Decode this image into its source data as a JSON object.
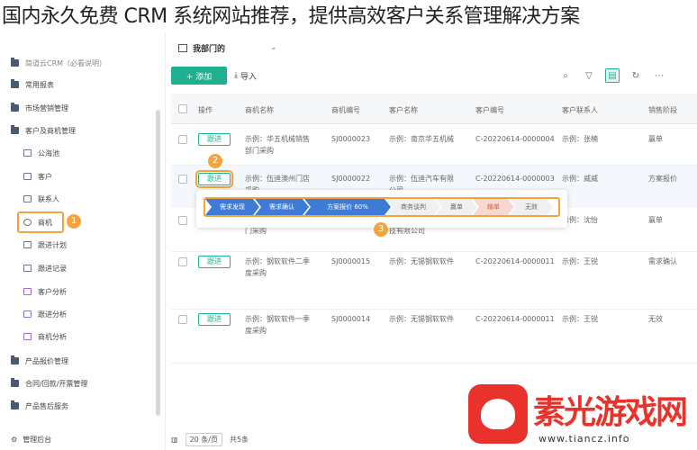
{
  "overlay_title": "国内永久免费 CRM 系统网站推荐，提供高效客户关系管理解决方案",
  "sidebar": {
    "items": [
      {
        "label": "简道云CRM（必看说明）",
        "type": "folder"
      },
      {
        "label": "常用报表",
        "type": "folder"
      },
      {
        "label": "市场营销管理",
        "type": "folder"
      },
      {
        "label": "客户及商机管理",
        "type": "folder"
      },
      {
        "label": "公海池",
        "type": "sub"
      },
      {
        "label": "客户",
        "type": "sub"
      },
      {
        "label": "联系人",
        "type": "sub"
      },
      {
        "label": "商机",
        "type": "sub"
      },
      {
        "label": "跟进计划",
        "type": "sub"
      },
      {
        "label": "跟进记录",
        "type": "sub"
      },
      {
        "label": "客户分析",
        "type": "sub"
      },
      {
        "label": "跟进分析",
        "type": "sub"
      },
      {
        "label": "商机分析",
        "type": "sub"
      },
      {
        "label": "产品报价管理",
        "type": "folder"
      },
      {
        "label": "合同/回款/开票管理",
        "type": "folder"
      },
      {
        "label": "产品售后服务",
        "type": "folder"
      }
    ],
    "admin_label": "管理后台"
  },
  "badges": {
    "one": "1",
    "two": "2",
    "three": "3"
  },
  "topbar": {
    "view_name": "我部门的",
    "chevron": "⌄"
  },
  "toolbar": {
    "add_label": "+ 添加",
    "import_label": "导入",
    "icons": [
      "search-icon",
      "filter-icon",
      "card-view-icon",
      "refresh-icon",
      "more-icon"
    ]
  },
  "table": {
    "headers": [
      "操作",
      "商机名称",
      "商机编号",
      "客户名称",
      "客户编号",
      "客户联系人",
      "销售阶段"
    ],
    "follow_label": "跟进",
    "rows": [
      {
        "name1": "示例：华五机械销售",
        "name2": "部门采购",
        "code": "SJ0000023",
        "cust1": "示例：南京华五机械",
        "cust2": "",
        "cust_code": "C-20220614-0000004",
        "contact": "示例：张楠",
        "stage": "赢单"
      },
      {
        "name1": "示例：伍迪澳州门店",
        "name2": "采购",
        "code": "SJ0000022",
        "cust1": "示例：伍迪汽车有限",
        "cust2": "公司",
        "cust_code": "C-20220614-0000003",
        "contact": "示例：威威",
        "stage": "方案报价"
      },
      {
        "name1": "",
        "name2": "门采购",
        "code": "",
        "cust1": "",
        "cust2": "技有限公司",
        "cust_code": "",
        "contact": "示例：沈怡",
        "stage": "赢单"
      },
      {
        "name1": "示例：钢软软件二季",
        "name2": "度采购",
        "code": "SJ0000015",
        "cust1": "示例：无锡钢软软件",
        "cust2": "",
        "cust_code": "C-20220614-0000011",
        "contact": "示例：王锐",
        "stage": "需求确认"
      },
      {
        "name1": "示例：钢软软件一季",
        "name2": "度采购",
        "code": "SJ0000014",
        "cust1": "示例：无锡钢软软件",
        "cust2": "",
        "cust_code": "C-20220614-0000011",
        "contact": "示例：王锐",
        "stage": "无效"
      }
    ]
  },
  "stage_popup": {
    "stages": [
      {
        "label": "需求发现",
        "state": "done"
      },
      {
        "label": "需求确认",
        "state": "done"
      },
      {
        "label": "方案报价 60%",
        "state": "done"
      },
      {
        "label": "商务谈判",
        "state": "todo"
      },
      {
        "label": "赢单",
        "state": "todo"
      },
      {
        "label": "输单",
        "state": "lost"
      },
      {
        "label": "无效",
        "state": "todo"
      }
    ]
  },
  "footer": {
    "page_size": "20 条/页",
    "total": "共5条"
  },
  "watermark": {
    "text": "素光游戏网",
    "url": "www.tiancz.info"
  }
}
